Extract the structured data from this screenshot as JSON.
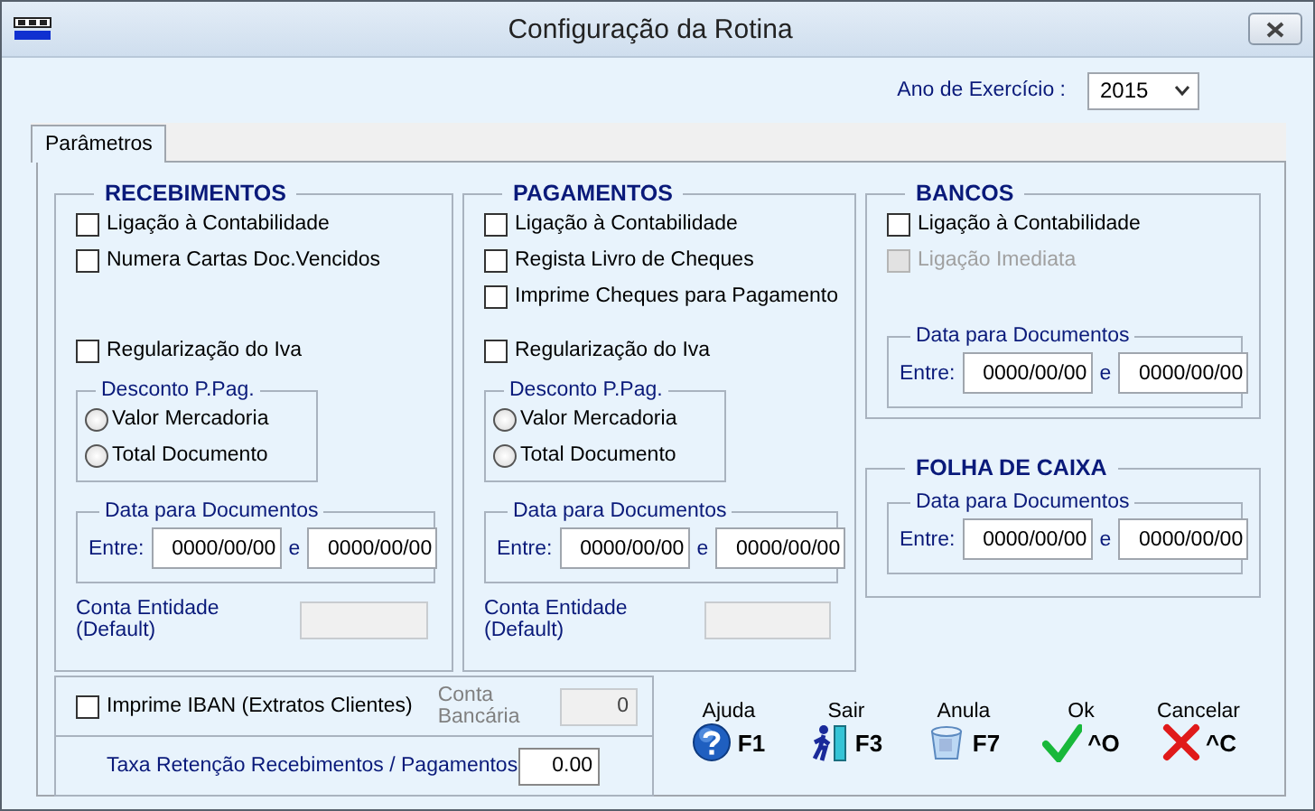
{
  "window": {
    "title": "Configuração da Rotina"
  },
  "year": {
    "label": "Ano de Exercício :",
    "value": "2015"
  },
  "tabs": [
    {
      "label": "Parâmetros",
      "selected": true
    }
  ],
  "columns": [
    {
      "groups": [
        {
          "title": "RECEBIMENTOS",
          "checkboxes": [
            {
              "label": "Ligação à Contabilidade",
              "checked": false,
              "disabled": false
            },
            {
              "label": "Numera Cartas Doc.Vencidos",
              "checked": false,
              "disabled": false
            }
          ],
          "iva": {
            "label": "Regularização do Iva",
            "checked": false
          },
          "discount": {
            "title": "Desconto P.Pag.",
            "options": [
              {
                "label": "Valor Mercadoria",
                "selected": false
              },
              {
                "label": "Total Documento",
                "selected": false
              }
            ]
          },
          "dates": {
            "title": "Data para Documentos",
            "from_label": "Entre:",
            "from": "0000/00/00",
            "joiner": "e",
            "to": "0000/00/00"
          },
          "account": {
            "label": "Conta Entidade (Default)",
            "disabled": true
          }
        }
      ]
    },
    {
      "groups": [
        {
          "title": "PAGAMENTOS",
          "checkboxes": [
            {
              "label": "Ligação à Contabilidade",
              "checked": false,
              "disabled": false
            },
            {
              "label": "Regista Livro de Cheques",
              "checked": false,
              "disabled": false
            },
            {
              "label": "Imprime Cheques para Pagamento",
              "checked": false,
              "disabled": false
            }
          ],
          "iva": {
            "label": "Regularização do Iva",
            "checked": false
          },
          "discount": {
            "title": "Desconto P.Pag.",
            "options": [
              {
                "label": "Valor Mercadoria",
                "selected": false
              },
              {
                "label": "Total Documento",
                "selected": false
              }
            ]
          },
          "dates": {
            "title": "Data para Documentos",
            "from_label": "Entre:",
            "from": "0000/00/00",
            "joiner": "e",
            "to": "0000/00/00"
          },
          "account": {
            "label": "Conta Entidade (Default)",
            "disabled": true
          }
        }
      ]
    },
    {
      "groups": [
        {
          "title": "BANCOS",
          "checkboxes": [
            {
              "label": "Ligação à Contabilidade",
              "checked": false,
              "disabled": false
            },
            {
              "label": "Ligação Imediata",
              "checked": false,
              "disabled": true
            }
          ],
          "dates": {
            "title": "Data para Documentos",
            "from_label": "Entre:",
            "from": "0000/00/00",
            "joiner": "e",
            "to": "0000/00/00"
          }
        },
        {
          "title": "FOLHA DE CAIXA",
          "dates": {
            "title": "Data para Documentos",
            "from_label": "Entre:",
            "from": "0000/00/00",
            "joiner": "e",
            "to": "0000/00/00"
          }
        }
      ]
    }
  ],
  "iban": {
    "label": "Imprime IBAN (Extratos Clientes)",
    "checked": false,
    "account_label": "Conta Bancária",
    "account_value": "0"
  },
  "retention": {
    "label": "Taxa Retenção Recebimentos / Pagamentos",
    "value": "0.00"
  },
  "buttons": [
    {
      "label": "Ajuda",
      "key": "F1",
      "kind": "help"
    },
    {
      "label": "Sair",
      "key": "F3",
      "kind": "exit"
    },
    {
      "label": "Anula",
      "key": "F7",
      "kind": "undo"
    },
    {
      "label": "Ok",
      "key": "^O",
      "kind": "ok"
    },
    {
      "label": "Cancelar",
      "key": "^C",
      "kind": "cancel"
    }
  ]
}
